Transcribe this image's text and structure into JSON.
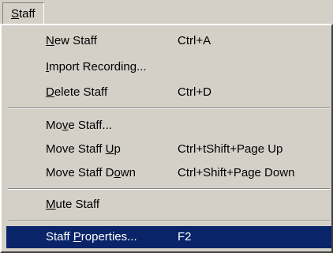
{
  "menubar": {
    "title_mnemonic": "S",
    "title_rest": "taff"
  },
  "menu": {
    "items": [
      {
        "pre": "",
        "mnemonic": "N",
        "post": "ew Staff",
        "shortcut": "Ctrl+A"
      },
      {
        "pre": "",
        "mnemonic": "I",
        "post": "mport Recording...",
        "shortcut": ""
      },
      {
        "pre": "",
        "mnemonic": "D",
        "post": "elete Staff",
        "shortcut": "Ctrl+D"
      },
      {
        "pre": "Mo",
        "mnemonic": "v",
        "post": "e Staff...",
        "shortcut": ""
      },
      {
        "pre": "Move Staff ",
        "mnemonic": "U",
        "post": "p",
        "shortcut": "Ctrl+tShift+Page Up"
      },
      {
        "pre": "Move Staff D",
        "mnemonic": "o",
        "post": "wn",
        "shortcut": "Ctrl+Shift+Page Down"
      },
      {
        "pre": "",
        "mnemonic": "M",
        "post": "ute Staff",
        "shortcut": ""
      },
      {
        "pre": "Staff ",
        "mnemonic": "P",
        "post": "roperties...",
        "shortcut": "F2"
      }
    ]
  },
  "colors": {
    "menu_bg": "#d4d0c8",
    "highlight": "#0a246a"
  }
}
